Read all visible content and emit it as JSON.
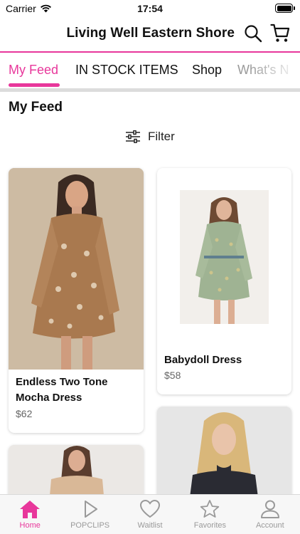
{
  "status_bar": {
    "carrier": "Carrier",
    "time": "17:54"
  },
  "header": {
    "title": "Living Well Eastern Shore"
  },
  "tabs": [
    {
      "label": "My Feed",
      "active": true
    },
    {
      "label": "IN STOCK ITEMS"
    },
    {
      "label": "Shop"
    },
    {
      "label": "What's N"
    }
  ],
  "feed": {
    "heading": "My Feed",
    "filter_label": "Filter"
  },
  "products": [
    {
      "name_line1": "Endless Two Tone",
      "name_line2": "Mocha Dress",
      "price": "$62"
    },
    {
      "name_line1": "Babydoll Dress",
      "name_line2": "",
      "price": "$58"
    }
  ],
  "tabbar": [
    {
      "label": "Home",
      "icon": "home-icon",
      "active": true
    },
    {
      "label": "POPCLIPS",
      "icon": "play-icon"
    },
    {
      "label": "Waitlist",
      "icon": "heart-icon"
    },
    {
      "label": "Favorites",
      "icon": "star-icon"
    },
    {
      "label": "Account",
      "icon": "person-icon"
    }
  ],
  "colors": {
    "accent": "#e8379b",
    "tab_inactive": "#9a9a9a"
  }
}
